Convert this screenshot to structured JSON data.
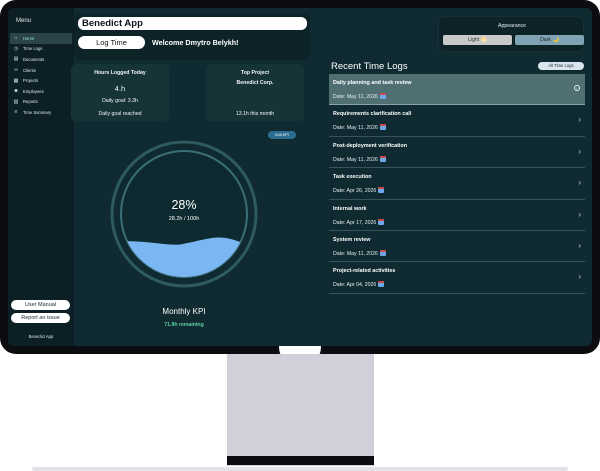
{
  "sidebar": {
    "title": "Menu",
    "items": [
      {
        "label": "Home",
        "icon": "home-icon",
        "active": true
      },
      {
        "label": "Time Logs",
        "icon": "clock-icon"
      },
      {
        "label": "Documents",
        "icon": "document-icon"
      },
      {
        "label": "Clients",
        "icon": "link-icon"
      },
      {
        "label": "Projects",
        "icon": "grid-icon"
      },
      {
        "label": "Employees",
        "icon": "people-icon"
      },
      {
        "label": "Reports",
        "icon": "report-icon"
      },
      {
        "label": "Time Summary",
        "icon": "summary-icon"
      }
    ],
    "user_manual": "User Manual",
    "report_issue": "Report an issue",
    "footer": "Benedict App"
  },
  "header": {
    "app_title": "Benedict App",
    "log_time": "Log Time",
    "welcome": "Welcome Dmytro Belykh!"
  },
  "appearance": {
    "title": "Appearance",
    "light": "Light 🌕",
    "dark": "Dark 🌙"
  },
  "stats": {
    "hours_title": "Hours Logged Today",
    "hours_value": "4.h",
    "daily_goal": "Daily goal: 3.3h",
    "goal_status": "Daily goal reached",
    "top_project_title": "Top Project",
    "top_project_name": "Benedict Corp.",
    "top_project_hours": "13.1h this month"
  },
  "kpi": {
    "edit_label": "Edit KPI",
    "percent": "28%",
    "hours": "28.2h / 100h",
    "fill_fraction": 0.28,
    "label": "Monthly KPI",
    "remaining": "71.8h remaining"
  },
  "recent": {
    "title": "Recent Time Logs",
    "all_label": "All Time Logs",
    "logs": [
      {
        "title": "Daily planning and task review",
        "date": "Date: May 11, 2026",
        "selected": true
      },
      {
        "title": "Requirements clarification call",
        "date": "Date: May 11, 2026"
      },
      {
        "title": "Post-deployment verification",
        "date": "Date: May 11, 2026"
      },
      {
        "title": "Task execution",
        "date": "Date: Apr 26, 2026"
      },
      {
        "title": "Internal work",
        "date": "Date: Apr 17, 2026"
      },
      {
        "title": "System review",
        "date": "Date: May 11, 2026"
      },
      {
        "title": "Project-related activities",
        "date": "Date: Apr 04, 2026"
      }
    ]
  },
  "colors": {
    "background": "#0f2a30",
    "card": "#163338",
    "accent_green": "#5fd0a4",
    "water": "#79b6f2"
  }
}
